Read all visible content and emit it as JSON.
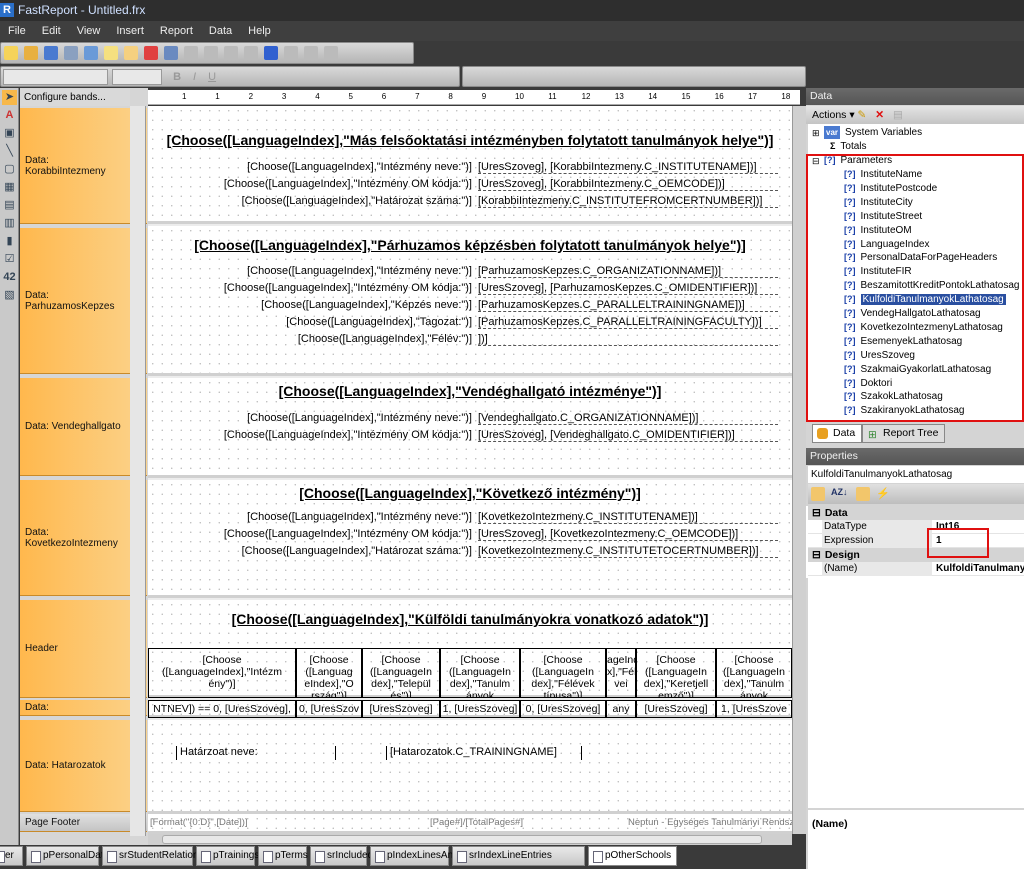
{
  "window": {
    "title": "FastReport - Untitled.frx",
    "logo": "R"
  },
  "menu": [
    "File",
    "Edit",
    "View",
    "Insert",
    "Report",
    "Data",
    "Help"
  ],
  "toolbox": {
    "configure_bands": "Configure bands..."
  },
  "ruler": [
    "1",
    "1",
    "2",
    "3",
    "4",
    "5",
    "6",
    "7",
    "8",
    "9",
    "10",
    "11",
    "12",
    "13",
    "14",
    "15",
    "16",
    "17",
    "18",
    "19"
  ],
  "bands": [
    {
      "label": "Data:\nKorabbiIntezmeny"
    },
    {
      "label": "Data:\nParhuzamosKepzes"
    },
    {
      "label": "Data: Vendeghallgato"
    },
    {
      "label": "Data:\nKovetkezoIntezmeny"
    },
    {
      "label": "Header"
    },
    {
      "label": "Data:"
    },
    {
      "label": "Data: Hatarozatok"
    },
    {
      "label": "Page Footer"
    }
  ],
  "report": {
    "korabbi": {
      "title": "[Choose([LanguageIndex],\"Más felsőoktatási intézményben folytatott tanulmányok helye\")]",
      "rows": [
        [
          "[Choose([LanguageIndex],\"Intézmény  neve:\")]",
          "[UresSzoveg],  [KorabbiIntezmeny.C_INSTITUTENAME])]"
        ],
        [
          "[Choose([LanguageIndex],\"Intézmény OM kódja:\")]",
          "[UresSzoveg],  [KorabbiIntezmeny.C_OEMCODE])]"
        ],
        [
          "[Choose([LanguageIndex],\"Határozat  száma:\")]",
          "[KorabbiIntezmeny.C_INSTITUTEFROMCERTNUMBER])]"
        ]
      ]
    },
    "parhuzamos": {
      "title": "[Choose([LanguageIndex],\"Párhuzamos képzésben folytatott tanulmányok helye\")]",
      "rows": [
        [
          "[Choose([LanguageIndex],\"Intézmény  neve:\")]",
          "[ParhuzamosKepzes.C_ORGANIZATIONNAME])]"
        ],
        [
          "[Choose([LanguageIndex],\"Intézmény OM kódja:\")]",
          "[UresSzoveg],  [ParhuzamosKepzes.C_OMIDENTIFIER])]"
        ],
        [
          "[Choose([LanguageIndex],\"Képzés  neve:\")]",
          "[ParhuzamosKepzes.C_PARALLELTRAININGNAME])]"
        ],
        [
          "[Choose([LanguageIndex],\"Tagozat:\")]",
          "[ParhuzamosKepzes.C_PARALLELTRAININGFACULTY])]"
        ],
        [
          "[Choose([LanguageIndex],\"Félév:\")]",
          "])]"
        ]
      ]
    },
    "vendeg": {
      "title": "[Choose([LanguageIndex],\"Vendéghallgató intézménye\")]",
      "rows": [
        [
          "[Choose([LanguageIndex],\"Intézmény  neve:\")]",
          "[Vendeghallgato.C_ORGANIZATIONNAME])]"
        ],
        [
          "[Choose([LanguageIndex],\"Intézmény OM kódja:\")]",
          "[UresSzoveg],  [Vendeghallgato.C_OMIDENTIFIER])]"
        ]
      ]
    },
    "kovetkezo": {
      "title": "[Choose([LanguageIndex],\"Következő intézmény\")]",
      "rows": [
        [
          "[Choose([LanguageIndex],\"Intézmény  neve:\")]",
          "[KovetkezoIntezmeny.C_INSTITUTENAME])]"
        ],
        [
          "[Choose([LanguageIndex],\"Intézmény OM kódja:\")]",
          "[UresSzoveg],  [KovetkezoIntezmeny.C_OEMCODE])]"
        ],
        [
          "[Choose([LanguageIndex],\"Határozat  száma:\")]",
          "[KovetkezoIntezmeny.C_INSTITUTETOCERTNUMBER])]"
        ]
      ]
    },
    "header": {
      "title": "[Choose([LanguageIndex],\"Külföldi tanulmányokra vonatkozó adatok\")]",
      "columns": [
        "[Choose ([LanguageIndex],\"Intézm ény\")]",
        "[Choose ([Languag eIndex],\"O rszág\")]",
        "[Choose ([LanguageIn dex],\"Települ és\")]",
        "[Choose ([LanguageIn dex],\"Tanulm ányok",
        "[Choose ([LanguageIn dex],\"Félévek típusa\")]",
        "ageInde x],\"Félé vei",
        "[Choose ([LanguageIn dex],\"Keretjell emző\")]",
        "[Choose ([LanguageIn dex],\"Tanulm ányok"
      ],
      "data_row": [
        "NTNEV]) == 0, [UresSzoveg],",
        "0, [UresSzov",
        "[UresSzoveg]",
        "1, [UresSzoveg]",
        "0, [UresSzoveg]",
        "any",
        "[UresSzoveg]",
        "1, [UresSzove"
      ]
    },
    "hatarozatok": {
      "label": "Határzoat neve:",
      "value": "[Hatarozatok.C_TRAININGNAME]"
    },
    "footer": {
      "left": "[Format(\"{0:D}\",[Date])]",
      "center": "[Page#]/[TotalPages#]",
      "right": "Neptun - Egységes Tanulmányi Rendsz"
    }
  },
  "page_tabs": [
    "er",
    "pPersonalData",
    "srStudentRelation",
    "pTrainings",
    "pTerms",
    "srIncludedCredits",
    "pIndexLinesAndEntries",
    "srIndexLineEntries",
    "pOtherSchools"
  ],
  "active_page_tab": "pOtherSchools",
  "data_panel": {
    "title": "Data",
    "actions": "Actions",
    "system_variables": "System Variables",
    "totals": "Totals",
    "parameters": "Parameters",
    "params": [
      "InstituteName",
      "InstitutePostcode",
      "InstituteCity",
      "InstituteStreet",
      "InstituteOM",
      "LanguageIndex",
      "PersonalDataForPageHeaders",
      "InstituteFIR",
      "BeszamitottKreditPontokLathatosag",
      "KulfoldiTanulmanyokLathatosag",
      "VendegHallgatoLathatosag",
      "KovetkezoIntezmenyLathatosag",
      "EsemenyekLathatosag",
      "UresSzoveg",
      "SzakmaiGyakorlatLathatosag",
      "Doktori",
      "SzakokLathatosag",
      "SzakiranyokLathatosag"
    ],
    "selected": "KulfoldiTanulmanyokLathatosag",
    "tabs": [
      "Data",
      "Report Tree"
    ]
  },
  "properties": {
    "title": "Properties",
    "object": "KulfoldiTanulmanyokLathatosag",
    "groups": [
      {
        "name": "Data",
        "rows": [
          [
            "DataType",
            "Int16"
          ],
          [
            "Expression",
            "1"
          ]
        ]
      },
      {
        "name": "Design",
        "rows": [
          [
            "(Name)",
            "KulfoldiTanulmanyokLathatosag"
          ]
        ]
      }
    ],
    "description": "(Name)"
  },
  "colors": {
    "band": "#ffb84d",
    "highlight": "#e01010",
    "selection": "#2a4fa0"
  }
}
